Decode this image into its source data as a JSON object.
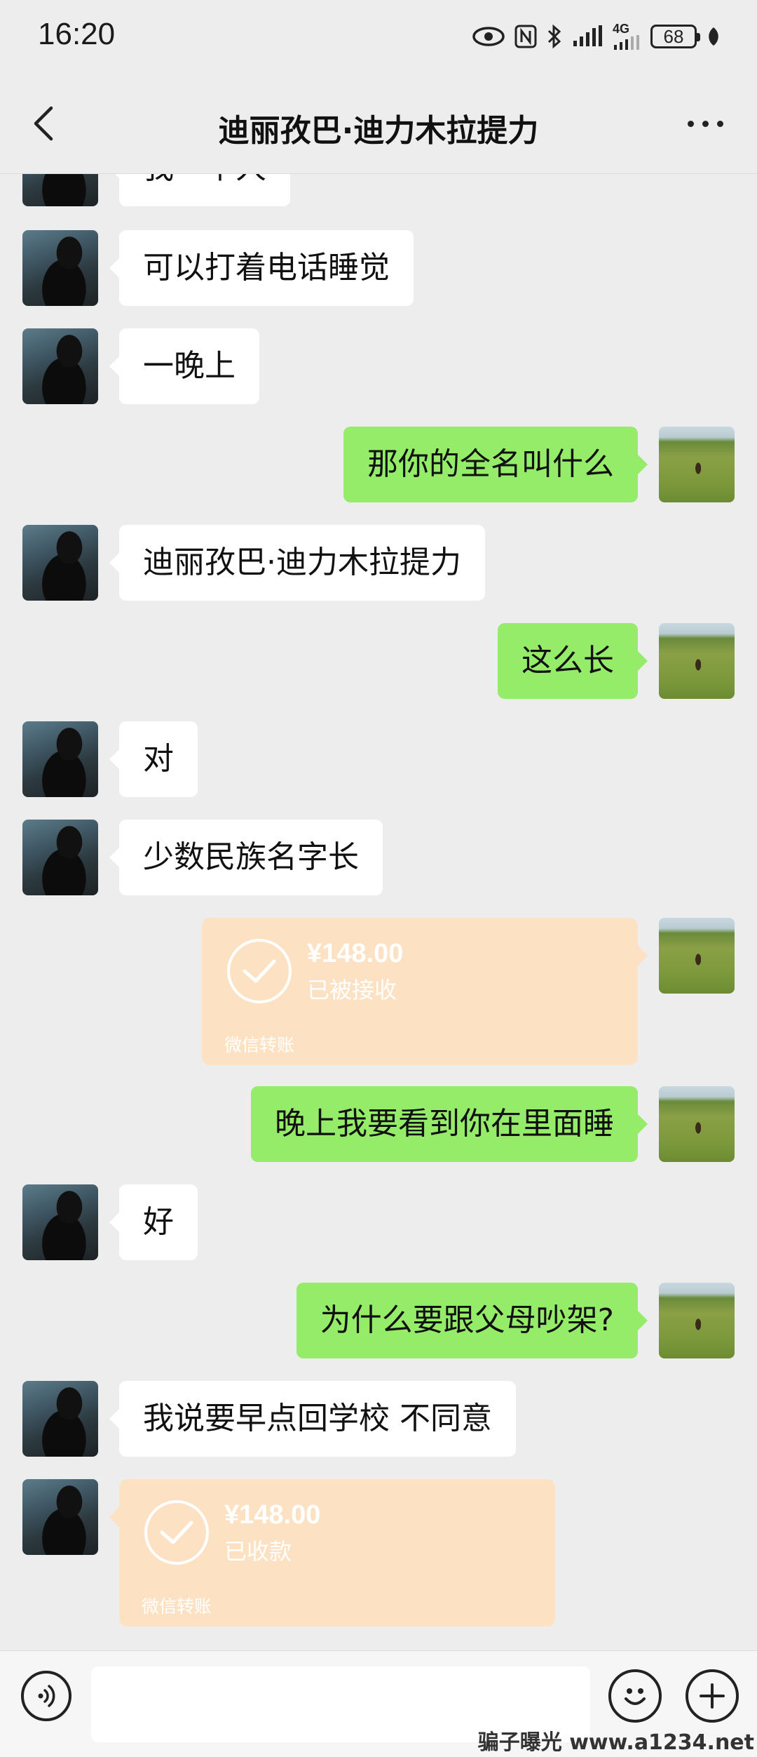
{
  "status_bar": {
    "time": "16:20",
    "network": "4G",
    "battery": "68"
  },
  "header": {
    "title": "迪丽孜巴·迪力木拉提力"
  },
  "messages": [
    {
      "side": "in",
      "type": "text",
      "text": "我一个人"
    },
    {
      "side": "in",
      "type": "text",
      "text": "可以打着电话睡觉"
    },
    {
      "side": "in",
      "type": "text",
      "text": "一晚上"
    },
    {
      "side": "out",
      "type": "text",
      "text": "那你的全名叫什么"
    },
    {
      "side": "in",
      "type": "text",
      "text": "迪丽孜巴·迪力木拉提力"
    },
    {
      "side": "out",
      "type": "text",
      "text": "这么长"
    },
    {
      "side": "in",
      "type": "text",
      "text": "对"
    },
    {
      "side": "in",
      "type": "text",
      "text": "少数民族名字长"
    },
    {
      "side": "out",
      "type": "transfer",
      "amount": "¥148.00",
      "status": "已被接收",
      "footer": "微信转账"
    },
    {
      "side": "out",
      "type": "text",
      "text": "晚上我要看到你在里面睡"
    },
    {
      "side": "in",
      "type": "text",
      "text": "好"
    },
    {
      "side": "out",
      "type": "text",
      "text": "为什么要跟父母吵架?"
    },
    {
      "side": "in",
      "type": "text",
      "text": "我说要早点回学校 不同意"
    },
    {
      "side": "in",
      "type": "transfer",
      "amount": "¥148.00",
      "status": "已收款",
      "footer": "微信转账"
    }
  ],
  "input": {
    "value": "",
    "placeholder": ""
  },
  "icons": {
    "back": "chevron-left-icon",
    "more": "more-dots-icon",
    "voice": "voice-icon",
    "emoji": "emoji-icon",
    "plus": "plus-icon",
    "transfer_check": "check-circle-icon"
  },
  "colors": {
    "outgoing_bubble": "#95ec69",
    "incoming_bubble": "#ffffff",
    "transfer_card": "#fde1c3",
    "background": "#ededed"
  },
  "watermark": "骗子曝光 www.a1234.net"
}
